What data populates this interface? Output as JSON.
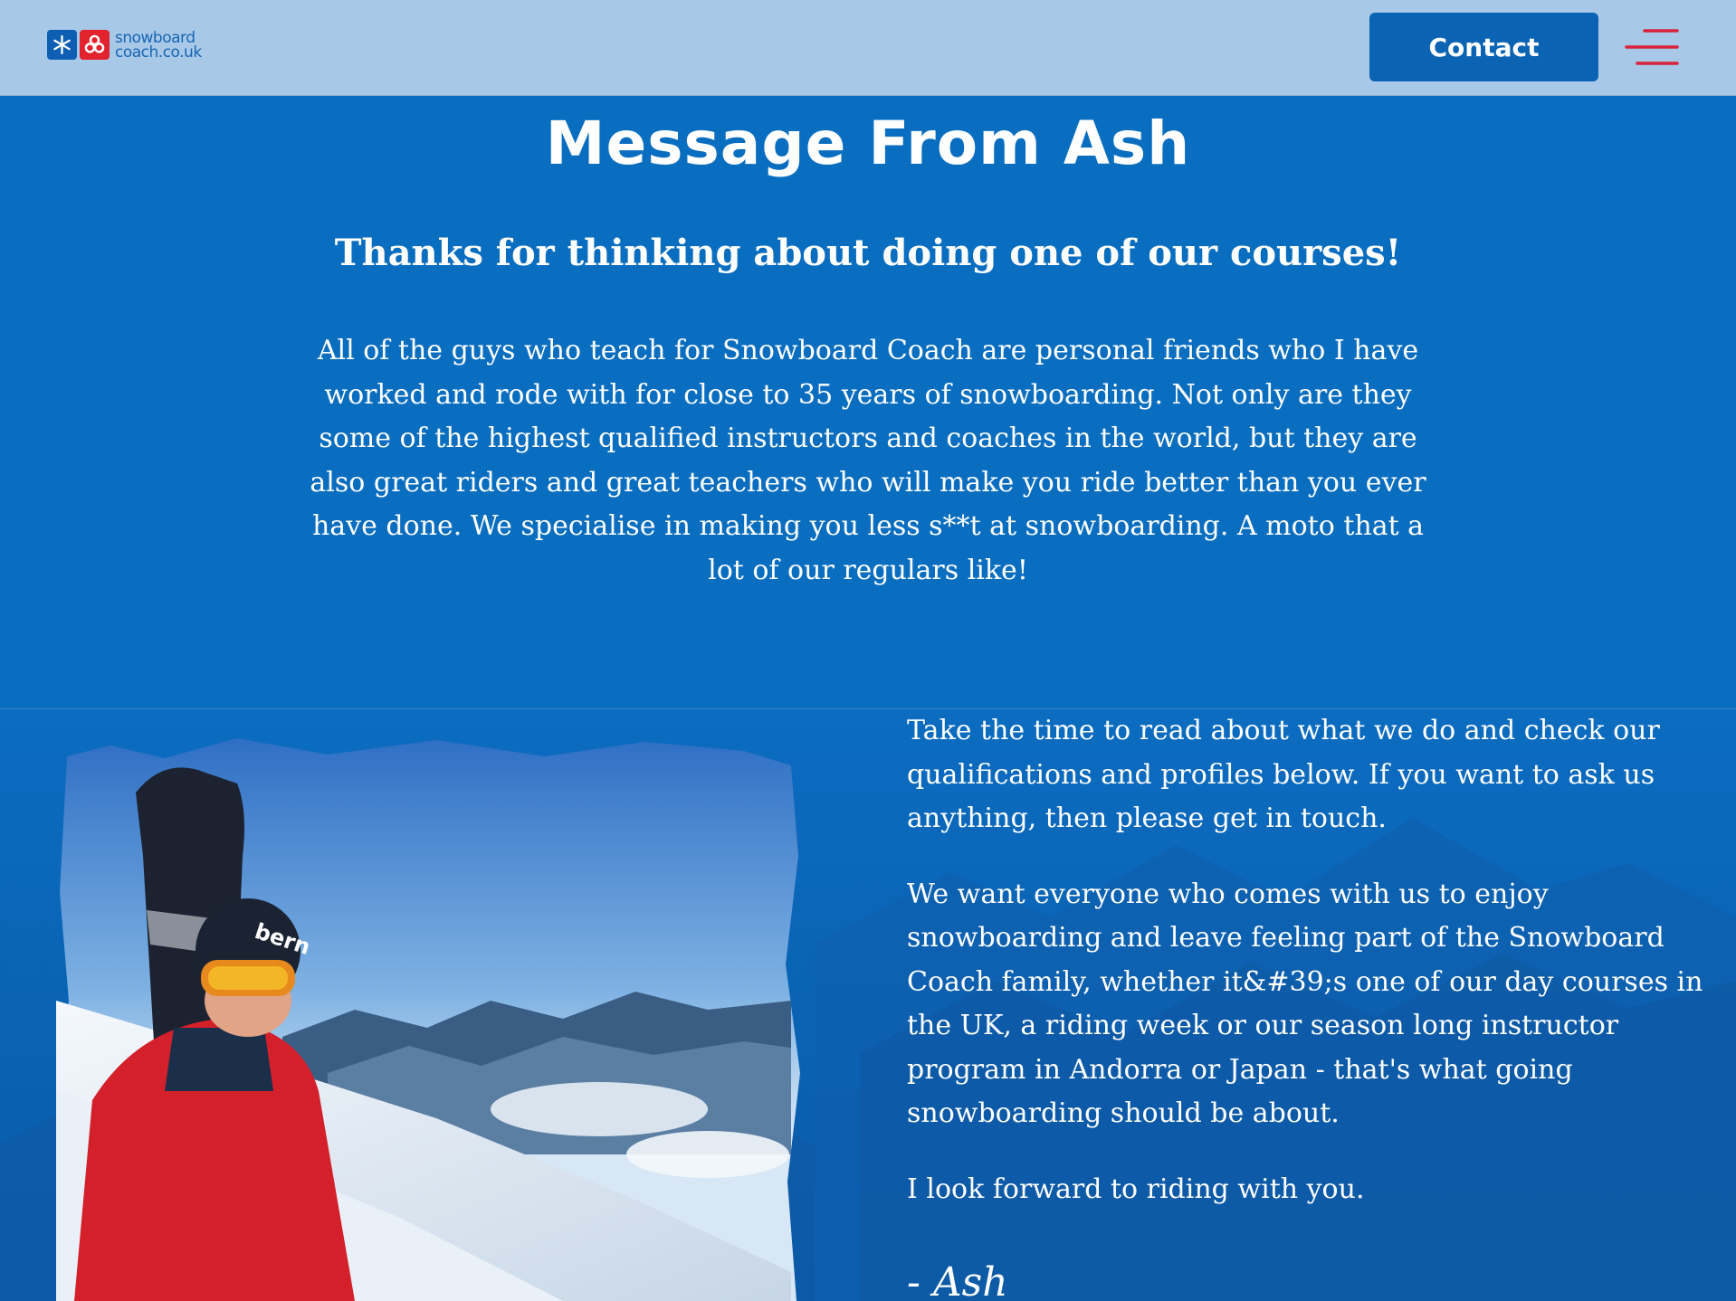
{
  "header": {
    "logo_text_line1": "snowboard",
    "logo_text_line2": "coach.co.uk",
    "contact_label": "Contact"
  },
  "intro": {
    "title": "Message From Ash",
    "subheading": "Thanks for thinking about doing one of our courses!",
    "paragraph": "All of the guys who teach for Snowboard Coach are personal friends who I have worked and rode with for close to 35 years of snowboarding. Not only are they some of the highest qualified instructors and coaches in the world, but they are also great riders and great teachers who will make you ride better than you ever have done. We specialise in making you less s**t at snowboarding. A moto that a lot of our regulars like!"
  },
  "message": {
    "paragraphs": [
      "Take the time to read about what we do and check our qualifications and profiles below. If you want to ask us anything, then please get in touch.",
      "We want everyone who comes with us to enjoy snowboarding and leave feeling part of the Snowboard Coach family, whether it&#39;s one of our day courses in the UK, a riding week or our season long instructor program in Andorra or Japan - that's what going snowboarding should be about.",
      "I look forward to riding with you."
    ],
    "signature": "- Ash"
  },
  "colors": {
    "header_bg": "#a8c8e8",
    "page_bg": "#0a6ec0",
    "button_bg": "#0b64b3",
    "menu_icon": "#d8233a",
    "logo_red": "#e2222c"
  },
  "icons": {
    "logo": "snowflake-and-rings-logo",
    "menu": "hamburger-menu-icon"
  }
}
